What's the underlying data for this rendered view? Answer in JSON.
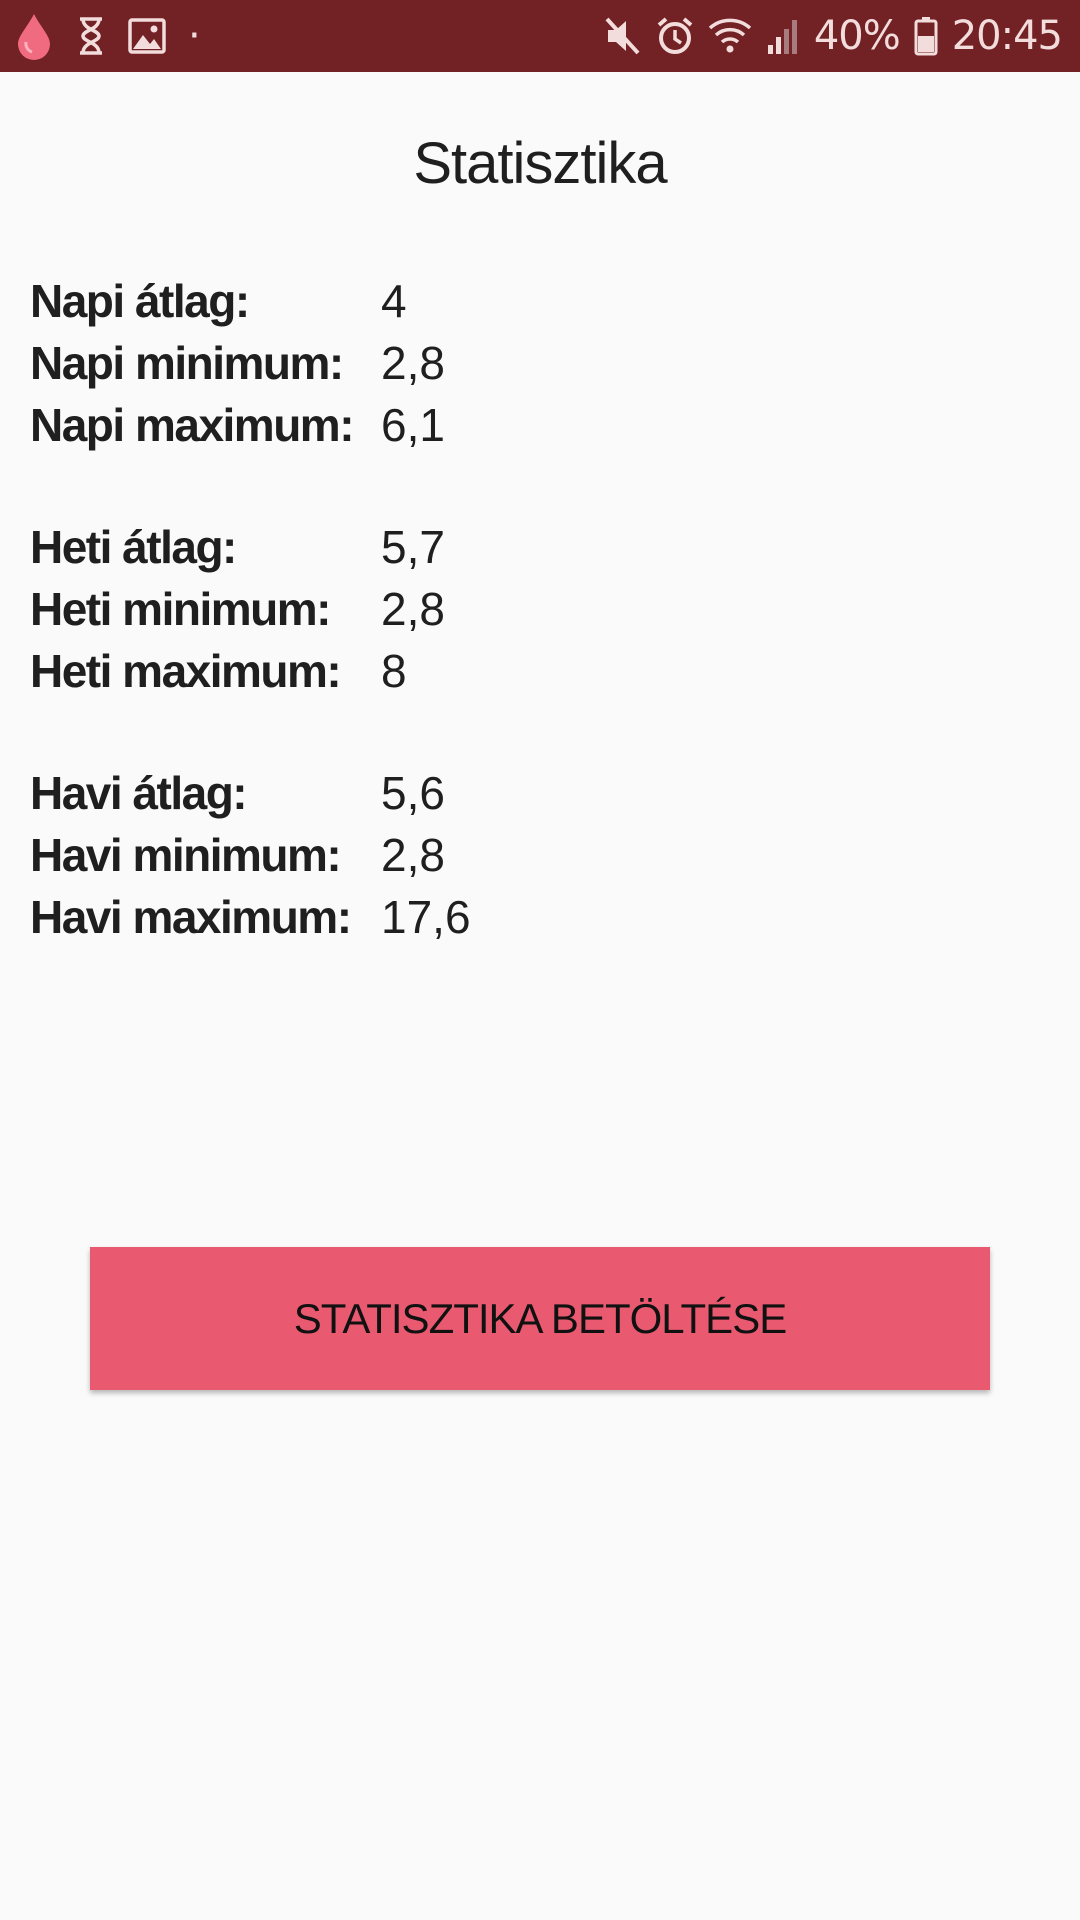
{
  "status_bar": {
    "battery_percent": "40%",
    "time": "20:45",
    "dot": "·",
    "background_color": "#722125",
    "icons_left": [
      "blood-drop-icon",
      "hourglass-icon",
      "image-icon"
    ],
    "icons_right": [
      "mute-icon",
      "alarm-icon",
      "wifi-icon",
      "signal-icon",
      "battery-icon"
    ]
  },
  "page": {
    "title": "Statisztika"
  },
  "stats": {
    "daily": [
      {
        "label": "Napi átlag:",
        "value": "4"
      },
      {
        "label": "Napi minimum:",
        "value": "2,8"
      },
      {
        "label": "Napi maximum:",
        "value": "6,1"
      }
    ],
    "weekly": [
      {
        "label": "Heti átlag:",
        "value": "5,7"
      },
      {
        "label": "Heti minimum:",
        "value": "2,8"
      },
      {
        "label": "Heti maximum:",
        "value": "8"
      }
    ],
    "monthly": [
      {
        "label": "Havi átlag:",
        "value": "5,6"
      },
      {
        "label": "Havi minimum:",
        "value": "2,8"
      },
      {
        "label": "Havi maximum:",
        "value": "17,6"
      }
    ]
  },
  "actions": {
    "load_button_label": "STATISZTIKA BETÖLTÉSE",
    "button_color": "#e95a70"
  }
}
